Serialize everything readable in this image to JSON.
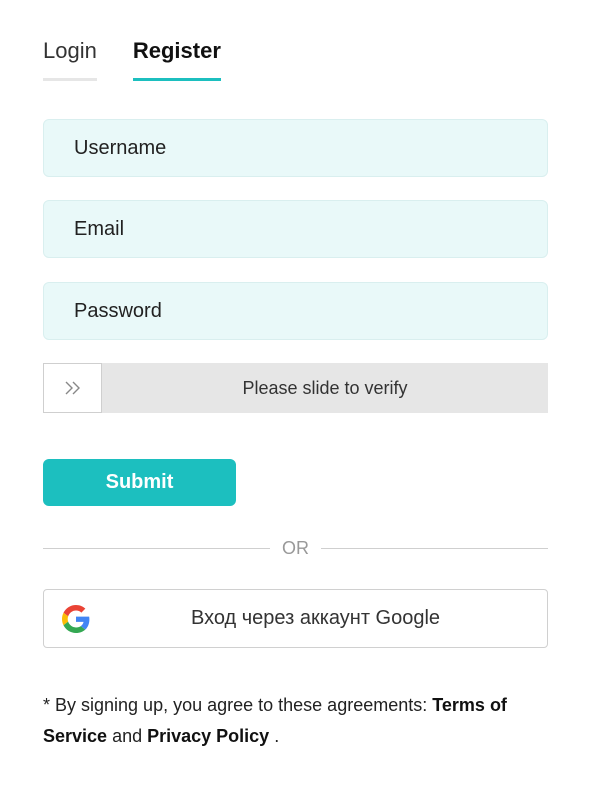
{
  "tabs": [
    {
      "label": "Login",
      "active": false
    },
    {
      "label": "Register",
      "active": true
    }
  ],
  "form": {
    "username_placeholder": "Username",
    "username_value": "",
    "email_placeholder": "Email",
    "email_value": "",
    "password_placeholder": "Password",
    "password_value": ""
  },
  "slider": {
    "text": "Please slide to verify",
    "icon": "double-chevron-right-icon",
    "progress": 0
  },
  "submit_label": "Submit",
  "divider_text": "OR",
  "google": {
    "label": "Вход через аккаунт Google",
    "icon": "google-icon"
  },
  "terms": {
    "prefix": "* By signing up, you agree to these agreements: ",
    "terms_link": "Terms of Service",
    "conjunction": " and ",
    "privacy_link": "Privacy Policy",
    "suffix": " ."
  },
  "colors": {
    "accent": "#1cbfbf",
    "field_bg": "#e9f9f9",
    "slider_bg": "#e6e6e6"
  }
}
